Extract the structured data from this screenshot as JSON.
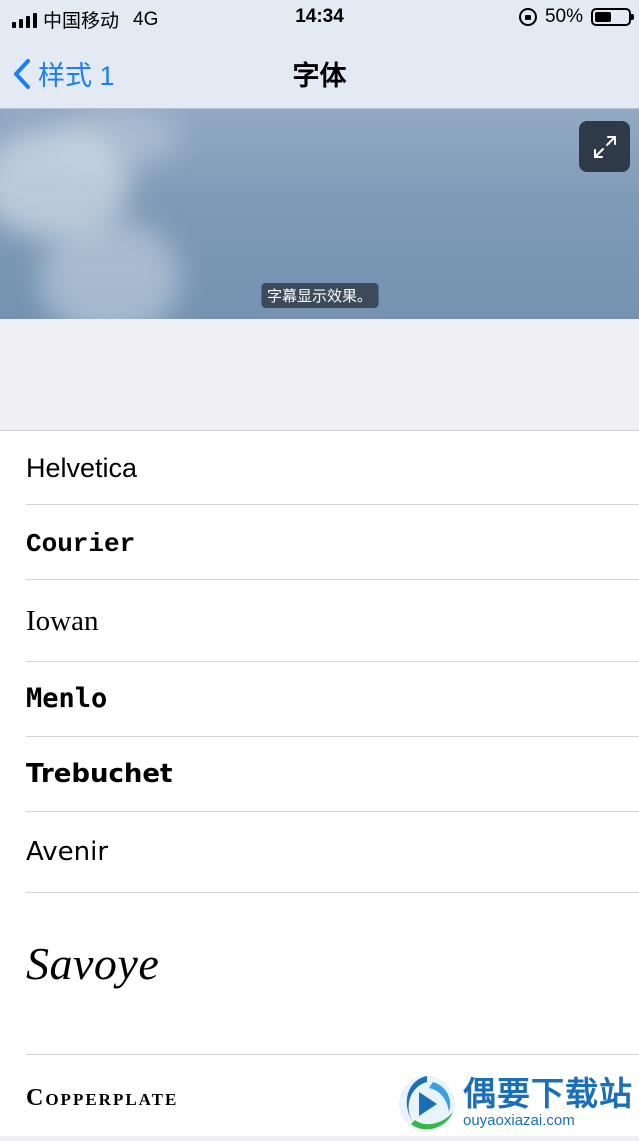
{
  "status_bar": {
    "carrier": "中国移动",
    "network": "4G",
    "time": "14:34",
    "battery_percent": "50%",
    "battery_level": 0.5
  },
  "nav": {
    "back_label": "样式 1",
    "title": "字体",
    "accent_color": "#1a7ef5"
  },
  "preview": {
    "subtitle_text": "字幕显示效果。",
    "expand_icon": "expand-arrows-icon"
  },
  "fonts": [
    {
      "label": "Helvetica"
    },
    {
      "label": "Courier"
    },
    {
      "label": "Iowan"
    },
    {
      "label": "Menlo"
    },
    {
      "label": "Trebuchet"
    },
    {
      "label": "Avenir"
    },
    {
      "label": "Savoye"
    },
    {
      "label": "Copperplate"
    }
  ],
  "watermark": {
    "title": "偶要下载站",
    "url": "ouyaoxiazai.com"
  }
}
